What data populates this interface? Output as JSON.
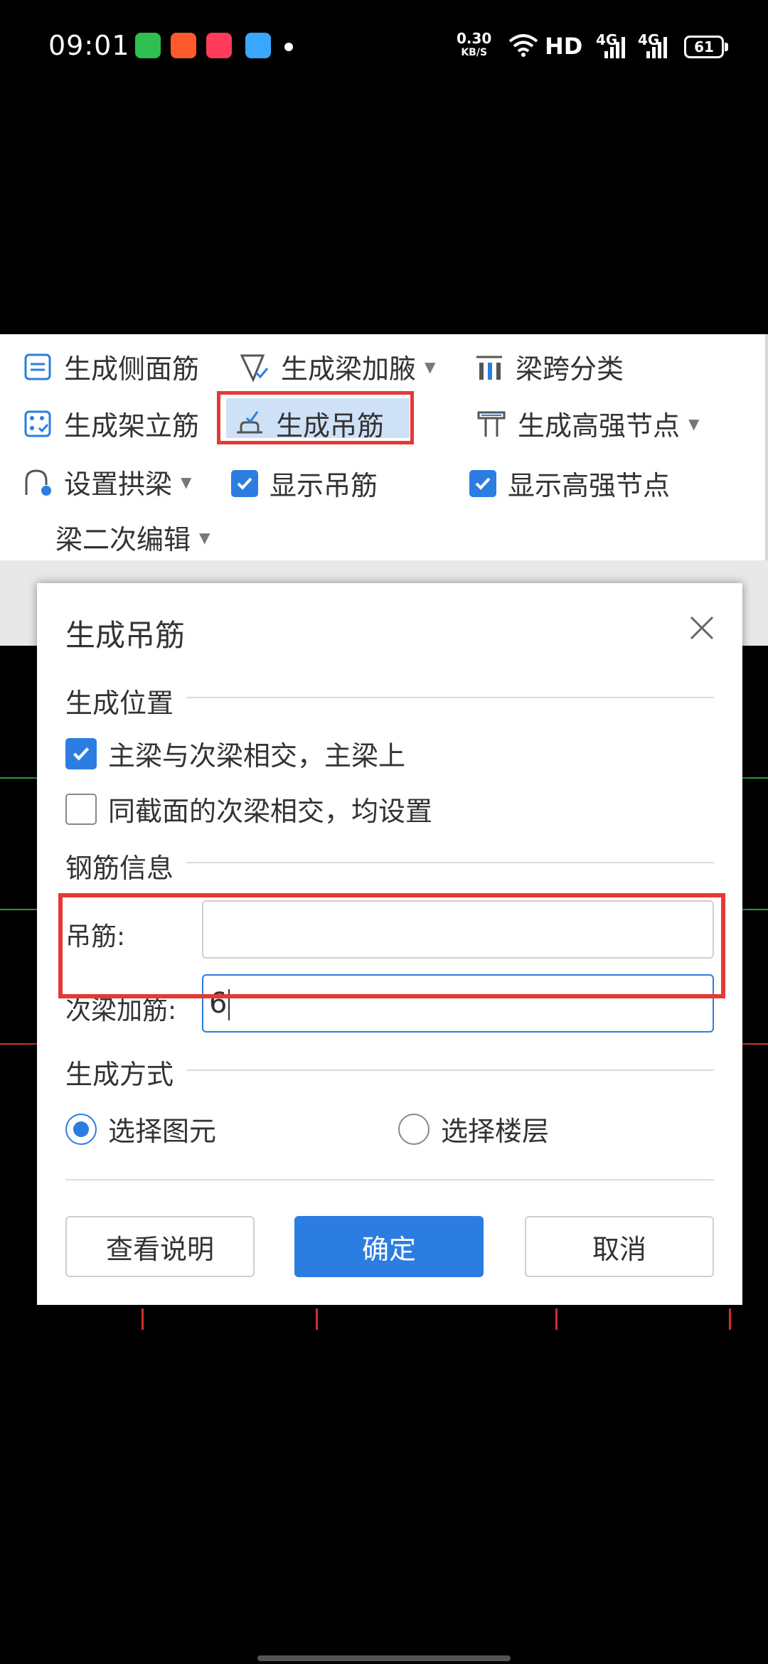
{
  "status_bar": {
    "time": "09:01",
    "net_speed": "0.30",
    "net_unit": "KB/S",
    "hd": "HD",
    "signal1": "4G",
    "signal2": "4G",
    "battery": "61",
    "app_colors": [
      "#2fbf4f",
      "#ff5a2b",
      "#ff3b5c",
      "#3aa7ff"
    ]
  },
  "ribbon": {
    "row1": [
      {
        "label": "生成侧面筋",
        "icon": "side-rebar-icon"
      },
      {
        "label": "生成梁加腋",
        "icon": "beam-haunch-icon",
        "dropdown": true
      },
      {
        "label": "梁跨分类",
        "icon": "span-classify-icon"
      }
    ],
    "row2": [
      {
        "label": "生成架立筋",
        "icon": "erection-rebar-icon"
      },
      {
        "label": "生成吊筋",
        "icon": "hanger-rebar-icon",
        "highlighted": true
      },
      {
        "label": "生成高强节点",
        "icon": "high-strength-node-icon",
        "dropdown": true
      }
    ],
    "row3": [
      {
        "label": "设置拱梁",
        "icon": "arch-beam-icon",
        "dropdown": true
      },
      {
        "label": "显示吊筋",
        "checked": true
      },
      {
        "label": "显示高强节点",
        "checked": true
      }
    ],
    "group_label": "梁二次编辑"
  },
  "dialog": {
    "title": "生成吊筋",
    "section_position": "生成位置",
    "options": [
      {
        "label": "主梁与次梁相交，主梁上",
        "checked": true
      },
      {
        "label": "同截面的次梁相交，均设置",
        "checked": false
      }
    ],
    "section_rebar": "钢筋信息",
    "hanger_label": "吊筋:",
    "hanger_value": "",
    "secondary_label": "次梁加筋:",
    "secondary_value": "6",
    "section_method": "生成方式",
    "method_options": [
      {
        "label": "选择图元",
        "selected": true
      },
      {
        "label": "选择楼层",
        "selected": false
      }
    ],
    "buttons": {
      "help": "查看说明",
      "ok": "确定",
      "cancel": "取消"
    }
  },
  "colors": {
    "accent": "#2b7de1",
    "highlight_border": "#e53935",
    "cad_green": "#2e9b3a",
    "cad_red": "#d32f2f"
  }
}
